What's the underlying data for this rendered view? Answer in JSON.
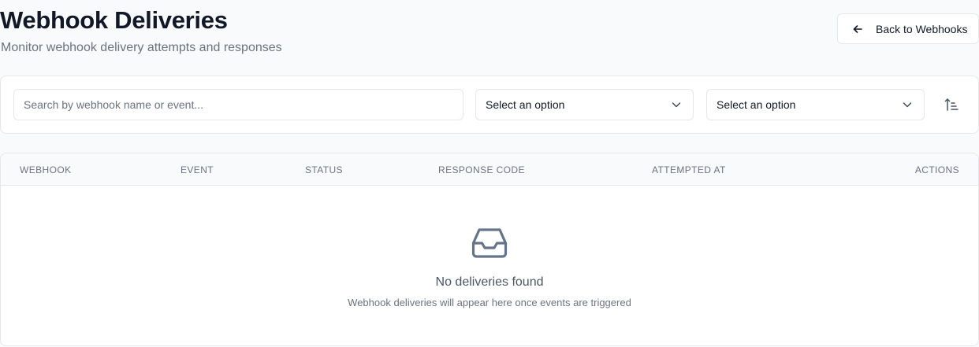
{
  "header": {
    "title": "Webhook Deliveries",
    "subtitle": "Monitor webhook delivery attempts and responses",
    "back_label": "Back to Webhooks",
    "back_icon": "arrow-left-icon"
  },
  "filters": {
    "search_placeholder": "Search by webhook name or event...",
    "search_value": "",
    "status_select": "Select an option",
    "event_select": "Select an option",
    "sort_icon": "sort-ascending-icon"
  },
  "table": {
    "columns": [
      "WEBHOOK",
      "EVENT",
      "STATUS",
      "RESPONSE CODE",
      "ATTEMPTED AT",
      "ACTIONS"
    ],
    "rows": []
  },
  "empty_state": {
    "icon": "inbox-icon",
    "title": "No deliveries found",
    "description": "Webhook deliveries will appear here once events are triggered"
  },
  "colors": {
    "background": "#f9fafb",
    "card": "#ffffff",
    "border": "#e5e7eb",
    "text_primary": "#111827",
    "text_muted": "#6b7280",
    "icon_gray": "#64748b"
  }
}
